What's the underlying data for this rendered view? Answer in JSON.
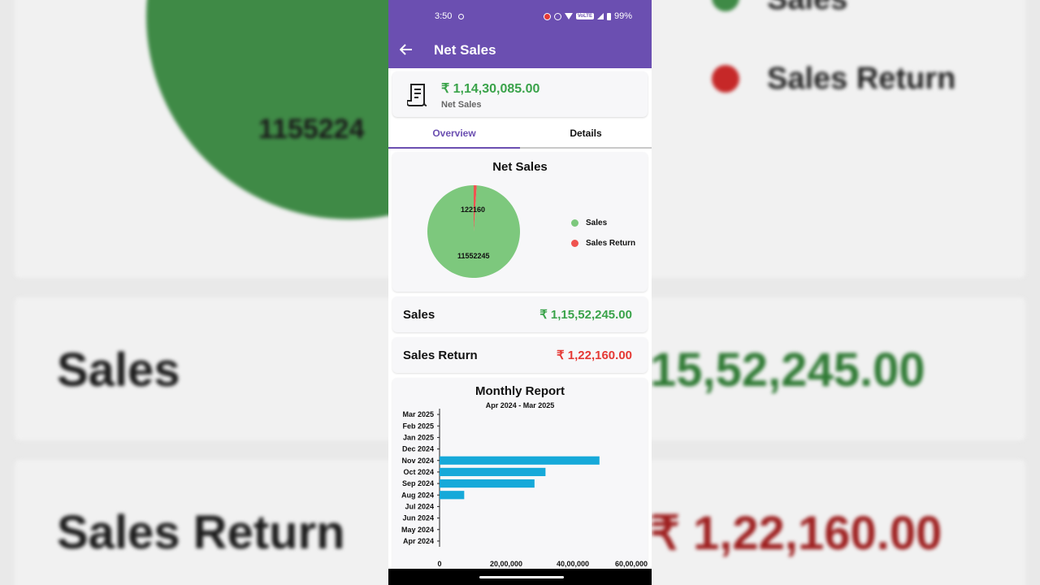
{
  "status_bar": {
    "time": "3:50",
    "battery": "99%",
    "network_badge": "VoLTE",
    "icons": [
      "location-icon",
      "record-icon",
      "dnd-icon",
      "wifi-icon",
      "signal-icon",
      "battery-icon"
    ]
  },
  "app_bar": {
    "title": "Net Sales",
    "back_icon": "arrow-back-icon"
  },
  "summary": {
    "amount": "₹ 1,14,30,085.00",
    "label": "Net Sales",
    "icon": "receipt-icon"
  },
  "tabs": [
    {
      "label": "Overview",
      "active": true
    },
    {
      "label": "Details",
      "active": false
    }
  ],
  "pie": {
    "title": "Net Sales",
    "slices": [
      {
        "name": "Sales",
        "value": 11552245,
        "label": "11552245",
        "color": "#7dc87d"
      },
      {
        "name": "Sales Return",
        "value": 122160,
        "label": "122160",
        "color": "#ef5350"
      }
    ],
    "legend": [
      {
        "label": "Sales",
        "color": "#7dc87d"
      },
      {
        "label": "Sales Return",
        "color": "#ef5350"
      }
    ]
  },
  "rows": {
    "sales": {
      "label": "Sales",
      "value": "₹ 1,15,52,245.00"
    },
    "sales_return": {
      "label": "Sales Return",
      "value": "₹ 1,22,160.00"
    }
  },
  "chart_data": {
    "type": "bar",
    "orientation": "horizontal",
    "title": "Monthly Report",
    "subtitle": "Apr 2024 - Mar 2025",
    "categories": [
      "Mar 2025",
      "Feb 2025",
      "Jan 2025",
      "Dec 2024",
      "Nov 2024",
      "Oct 2024",
      "Sep 2024",
      "Aug 2024",
      "Jul 2024",
      "Jun 2024",
      "May 2024",
      "Apr 2024"
    ],
    "values": [
      0,
      0,
      0,
      0,
      4800000,
      3180000,
      2850000,
      740000,
      0,
      0,
      0,
      0
    ],
    "xlim": [
      0,
      6000000
    ],
    "xticks": [
      {
        "value": 0,
        "label": "0"
      },
      {
        "value": 2000000,
        "label": "20,00,000"
      },
      {
        "value": 4000000,
        "label": "40,00,000"
      },
      {
        "value": 6000000,
        "label": "60,00,000"
      }
    ],
    "bar_color": "#16a9d9",
    "grid": false
  },
  "background": {
    "pie_label": "1155224",
    "legend_sales": "Sales",
    "legend_return": "Sales Return",
    "sales_label": "Sales",
    "sales_value": "15,52,245.00",
    "return_label": "Sales Return",
    "return_value": "₹ 1,22,160.00"
  }
}
